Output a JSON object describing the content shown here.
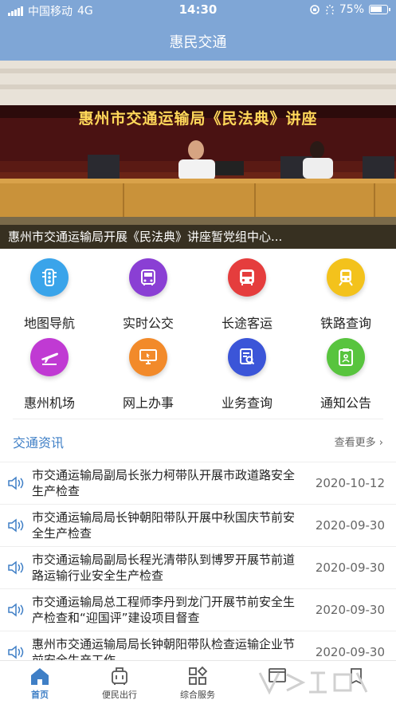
{
  "status_bar": {
    "carrier": "中国移动",
    "network": "4G",
    "time": "14:30",
    "battery": "75%",
    "battery_level": 0.75
  },
  "nav": {
    "title": "惠民交通"
  },
  "banner": {
    "sign_text": "惠州市交通运输局《民法典》讲座",
    "caption": "惠州市交通运输局开展《民法典》讲座暂党组中心..."
  },
  "services": [
    {
      "label": "地图导航",
      "icon": "traffic-light-icon",
      "color": "#3aa4ea"
    },
    {
      "label": "实时公交",
      "icon": "bus-icon",
      "color": "#8a3fd4"
    },
    {
      "label": "长途客运",
      "icon": "coach-icon",
      "color": "#e53d3d"
    },
    {
      "label": "铁路查询",
      "icon": "train-icon",
      "color": "#f3c21c"
    },
    {
      "label": "惠州机场",
      "icon": "airplane-icon",
      "color": "#c03ad3"
    },
    {
      "label": "网上办事",
      "icon": "computer-icon",
      "color": "#f28a2a"
    },
    {
      "label": "业务查询",
      "icon": "search-document-icon",
      "color": "#3b55d8"
    },
    {
      "label": "通知公告",
      "icon": "notice-icon",
      "color": "#58c43e"
    }
  ],
  "news": {
    "title": "交通资讯",
    "more": "查看更多",
    "items": [
      {
        "headline": "市交通运输局副局长张力柯带队开展市政道路安全生产检查",
        "date": "2020-10-12"
      },
      {
        "headline": "市交通运输局局长钟朝阳带队开展中秋国庆节前安全生产检查",
        "date": "2020-09-30"
      },
      {
        "headline": "市交通运输局副局长程光清带队到博罗开展节前道路运输行业安全生产检查",
        "date": "2020-09-30"
      },
      {
        "headline": "市交通运输局总工程师李丹到龙门开展节前安全生产检查和“迎国评”建设项目督查",
        "date": "2020-09-30"
      },
      {
        "headline": "惠州市交通运输局局长钟朝阳带队检查运输企业节前安全生产工作",
        "date": "2020-09-30"
      }
    ]
  },
  "tabs": [
    {
      "label": "首页",
      "icon": "home-icon",
      "active": true
    },
    {
      "label": "便民出行",
      "icon": "luggage-icon",
      "active": false
    },
    {
      "label": "综合服务",
      "icon": "apps-icon",
      "active": false
    },
    {
      "label": "",
      "icon": "message-icon",
      "active": false
    },
    {
      "label": "",
      "icon": "profile-icon",
      "active": false
    }
  ]
}
